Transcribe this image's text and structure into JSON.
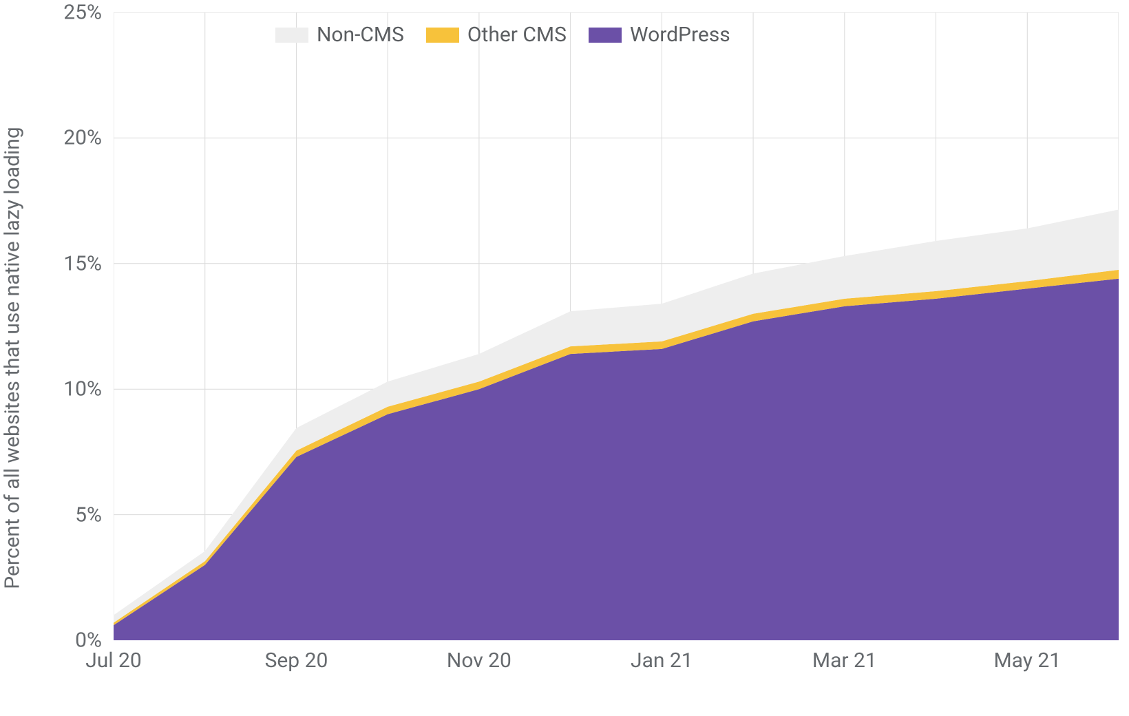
{
  "chart_data": {
    "type": "area",
    "ylabel": "Percent of all websites that use native lazy loading",
    "xlabel": "",
    "ylim": [
      0,
      25
    ],
    "y_ticks": [
      0,
      5,
      10,
      15,
      20,
      25
    ],
    "y_tick_labels": [
      "0%",
      "5%",
      "10%",
      "15%",
      "20%",
      "25%"
    ],
    "categories": [
      "Jul 20",
      "Aug 20",
      "Sep 20",
      "Oct 20",
      "Nov 20",
      "Dec 20",
      "Jan 21",
      "Feb 21",
      "Mar 21",
      "Apr 21",
      "May 21",
      "Jun 21"
    ],
    "x_tick_labels": [
      "Jul 20",
      "Sep 20",
      "Nov 20",
      "Jan 21",
      "Mar 21",
      "May 21"
    ],
    "x_tick_positions": [
      0,
      2,
      4,
      6,
      8,
      10
    ],
    "series": [
      {
        "name": "WordPress",
        "color": "#6b50a7",
        "values": [
          0.6,
          3.0,
          7.3,
          9.0,
          10.0,
          11.4,
          11.6,
          12.7,
          13.3,
          13.6,
          14.0,
          14.4
        ]
      },
      {
        "name": "Other CMS",
        "color": "#f7c23b",
        "values": [
          0.1,
          0.15,
          0.25,
          0.3,
          0.3,
          0.3,
          0.3,
          0.3,
          0.3,
          0.3,
          0.3,
          0.35
        ]
      },
      {
        "name": "Non-CMS",
        "color": "#eeeeee",
        "values": [
          0.3,
          0.4,
          0.9,
          1.0,
          1.1,
          1.4,
          1.5,
          1.6,
          1.7,
          2.0,
          2.1,
          2.4
        ]
      }
    ],
    "legend": {
      "position": "top",
      "order": [
        "Non-CMS",
        "Other CMS",
        "WordPress"
      ]
    },
    "grid": {
      "x": true,
      "y": true,
      "color": "#dadada"
    }
  }
}
